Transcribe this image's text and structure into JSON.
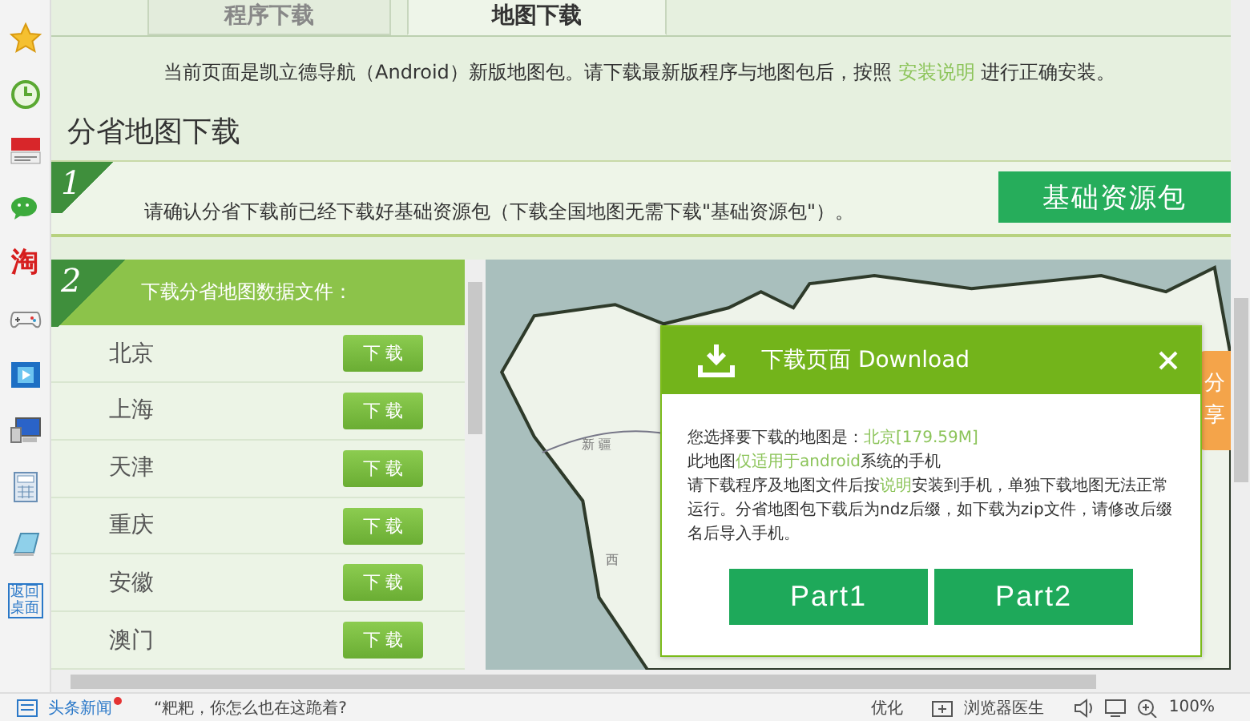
{
  "sidebar": [
    {
      "kind": "star"
    },
    {
      "kind": "clock"
    },
    {
      "kind": "news"
    },
    {
      "kind": "chat"
    },
    {
      "kind": "glyph",
      "text": "淘"
    },
    {
      "kind": "gamepad"
    },
    {
      "kind": "film"
    },
    {
      "kind": "computer"
    },
    {
      "kind": "calculator"
    },
    {
      "kind": "notepad"
    },
    {
      "kind": "desktop",
      "text": "返回桌面"
    }
  ],
  "tabs": [
    {
      "label": "程序下载",
      "selected": false
    },
    {
      "label": "地图下载",
      "selected": true
    }
  ],
  "notice": {
    "before": "当前页面是凯立德导航（Android）新版地图包。请下载最新版程序与地图包后，按照",
    "link": "安装说明",
    "after": "进行正确安装。"
  },
  "section_title": "分省地图下载",
  "step1": {
    "number": "1",
    "text": "请确认分省下载前已经下载好基础资源包（下载全国地图无需下载\"基础资源包\"）。",
    "button": "基础资源包"
  },
  "step2": {
    "number": "2",
    "title": "下载分省地图数据文件：",
    "provinces": [
      {
        "name": "北京",
        "button": "下 载"
      },
      {
        "name": "上海",
        "button": "下 载"
      },
      {
        "name": "天津",
        "button": "下 载"
      },
      {
        "name": "重庆",
        "button": "下 载"
      },
      {
        "name": "安徽",
        "button": "下 载"
      },
      {
        "name": "澳门",
        "button": "下 载"
      }
    ]
  },
  "map": {
    "labels": [
      "新 疆",
      "西"
    ]
  },
  "share_tab": "分享",
  "dialog": {
    "title": "下载页面 Download",
    "paragraphs": [
      [
        {
          "text": "您选择要下载的地图是："
        },
        {
          "text": "北京[179.59M]",
          "highlight": true
        }
      ],
      [
        {
          "text": "此地图"
        },
        {
          "text": "仅适用于android",
          "highlight": true
        },
        {
          "text": "系统的手机"
        }
      ],
      [
        {
          "text": "请下载程序及地图文件后按"
        },
        {
          "text": "说明",
          "highlight": true
        },
        {
          "text": "安装到手机，单独下载地图无法正常运行。分省地图包下载后为ndz后缀，如下载为zip文件，请修改后缀名后导入手机。"
        }
      ]
    ],
    "buttons": [
      "Part1",
      "Part2"
    ]
  },
  "status_bar": {
    "news_label": "头条新闻",
    "news_unread": true,
    "headline": "“粑粑，你怎么也在这跪着?",
    "items": [
      "优化",
      "浏览器医生"
    ],
    "zoom": "100%"
  }
}
